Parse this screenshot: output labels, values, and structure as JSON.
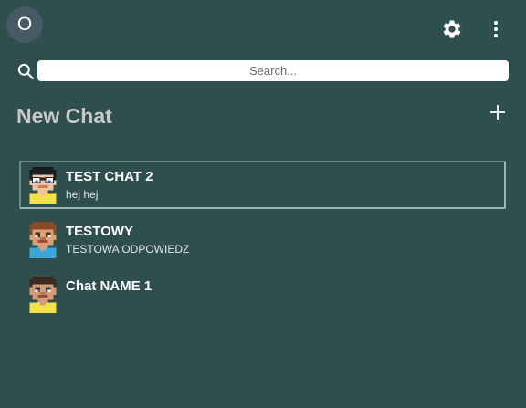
{
  "user": {
    "initial": "O"
  },
  "header": {
    "settings_icon": "gear-icon",
    "more_icon": "more-vert-icon"
  },
  "search": {
    "placeholder": "Search...",
    "value": "",
    "icon": "search-icon"
  },
  "new_chat": {
    "title": "New Chat",
    "add_icon": "plus-icon"
  },
  "chats": [
    {
      "name": "TEST CHAT 2",
      "preview": "hej hej",
      "active": true,
      "avatar": "pixel-avatar-glasses"
    },
    {
      "name": "TESTOWY",
      "preview": "TESTOWA ODPOWIEDZ",
      "active": false,
      "avatar": "pixel-avatar-brown-hair"
    },
    {
      "name": "Chat NAME 1",
      "preview": "",
      "active": false,
      "avatar": "pixel-avatar-dark-hair"
    }
  ],
  "colors": {
    "background": "#2f4f4f",
    "avatar_bg": "#455a64",
    "title_text": "#c8c8c8",
    "active_border": "#9fb3b3"
  }
}
